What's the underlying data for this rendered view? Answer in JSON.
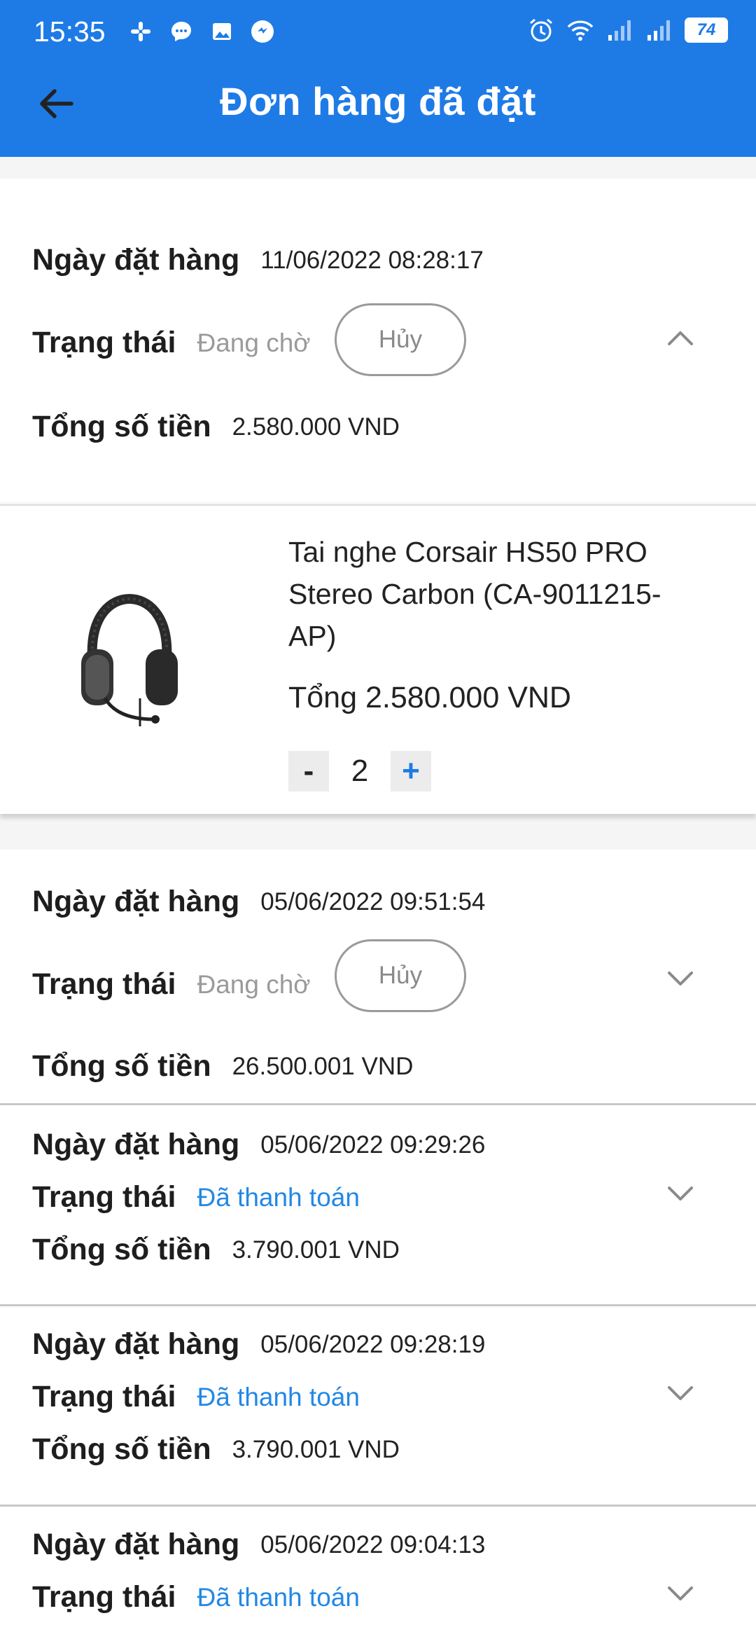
{
  "status_bar": {
    "time": "15:35",
    "battery": "74",
    "icons_left": [
      "slack-icon",
      "messenger-icon",
      "gallery-icon",
      "chat-bubble-icon"
    ],
    "icons_right": [
      "alarm-icon",
      "wifi-icon",
      "signal-icon",
      "signal-icon",
      "battery-icon"
    ]
  },
  "header": {
    "title": "Đơn hàng đã đặt",
    "back_icon": "arrow-left-icon"
  },
  "labels": {
    "order_date": "Ngày đặt hàng",
    "status": "Trạng thái",
    "total": "Tổng số tiền",
    "cancel": "Hủy"
  },
  "orders": [
    {
      "date": "11/06/2022 08:28:17",
      "status": "Đang chờ",
      "total": "2.580.000 VND",
      "expanded": true
    },
    {
      "date": "05/06/2022 09:51:54",
      "status": "Đang chờ",
      "total": "26.500.001 VND",
      "expanded": false
    },
    {
      "date": "05/06/2022 09:29:26",
      "status": "Đã thanh toán",
      "total": "3.790.001 VND",
      "expanded": false
    },
    {
      "date": "05/06/2022 09:28:19",
      "status": "Đã thanh toán",
      "total": "3.790.001 VND",
      "expanded": false
    },
    {
      "date": "05/06/2022 09:04:13",
      "status": "Đã thanh toán",
      "expanded": false
    }
  ],
  "product": {
    "name": "Tai nghe Corsair HS50 PRO Stereo Carbon (CA-9011215-AP)",
    "total": "Tổng 2.580.000 VND",
    "quantity": "2",
    "minus": "-",
    "plus": "+"
  },
  "colors": {
    "primary": "#1e7be6",
    "paid": "#2288e6",
    "pending": "#9a9a9a"
  }
}
